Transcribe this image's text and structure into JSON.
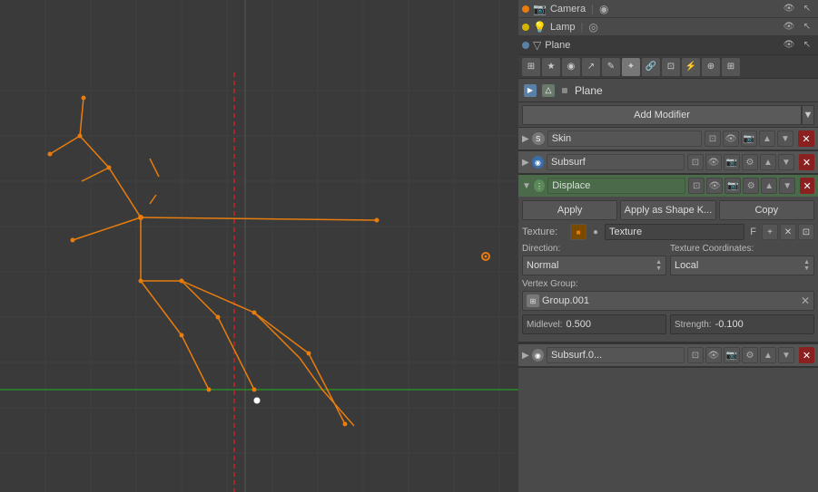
{
  "viewport": {
    "background": "#3a3a3a"
  },
  "scene_list": {
    "items": [
      {
        "name": "Camera",
        "icon": "camera",
        "dot": "orange"
      },
      {
        "name": "Lamp",
        "icon": "lamp",
        "dot": "yellow"
      },
      {
        "name": "Plane",
        "icon": "plane",
        "dot": "blue"
      }
    ]
  },
  "toolbar": {
    "icons": [
      "⊞",
      "★",
      "⟳",
      "↗",
      "✎",
      "✦",
      "🔗",
      "🔲",
      "⚡",
      "⊕",
      "⊞"
    ]
  },
  "object_name": {
    "label": "Plane"
  },
  "add_modifier": {
    "label": "Add Modifier"
  },
  "modifiers": [
    {
      "id": "skin",
      "name": "Skin",
      "icon_type": "grey",
      "collapsed": false
    },
    {
      "id": "subsurf",
      "name": "Subsurf",
      "icon_type": "blue",
      "collapsed": false
    },
    {
      "id": "displace",
      "name": "Displace",
      "icon_type": "green",
      "collapsed": false,
      "apply_label": "Apply",
      "apply_shape_label": "Apply as Shape K...",
      "copy_label": "Copy",
      "texture_section_label": "Texture:",
      "texture_name": "Texture",
      "texture_f_label": "F",
      "direction_label": "Direction:",
      "direction_value": "Normal",
      "tex_coords_label": "Texture Coordinates:",
      "tex_coords_value": "Local",
      "vertex_group_label": "Vertex Group:",
      "vertex_group_value": "Group.001",
      "midlevel_label": "Midlevel:",
      "midlevel_value": "0.500",
      "strength_label": "Strength:",
      "strength_value": "-0.100"
    }
  ],
  "subsurf_bottom": {
    "name": "Subsurf.0..."
  }
}
